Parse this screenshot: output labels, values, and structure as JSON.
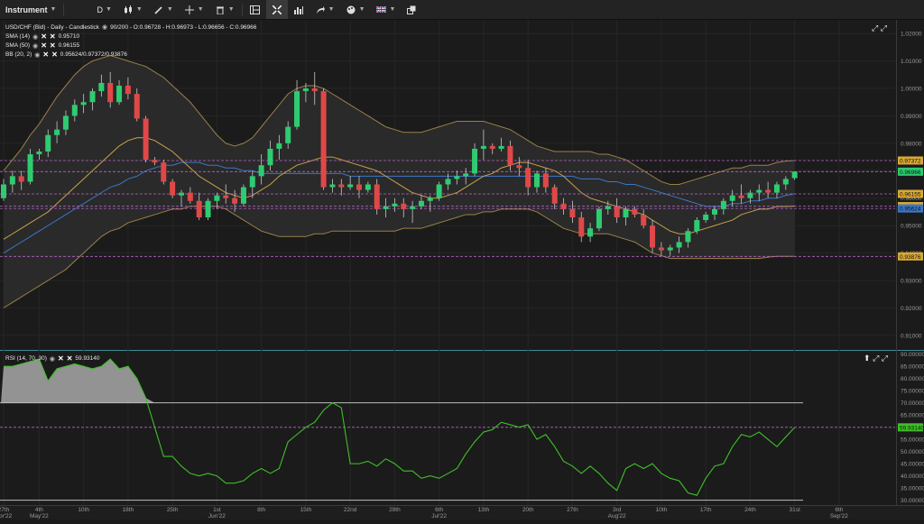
{
  "toolbar": {
    "instrument_label": "Instrument",
    "timeframe_label": "D"
  },
  "main_panel": {
    "title": "USD/CHF (Bid) - Daily - Candlestick",
    "ohlc": "90/200 - O:0.96728 - H:0.96973 - L:0.96656 - C:0.96966",
    "indicators": [
      {
        "name": "SMA (14)",
        "value": "0.95710"
      },
      {
        "name": "SMA (50)",
        "value": "0.96155"
      },
      {
        "name": "BB (20, 2)",
        "value": "0.95624/0.97372/0.93876"
      }
    ]
  },
  "rsi_panel": {
    "title": "RSI (14, 70, 30)",
    "value": "59.93140"
  },
  "colors": {
    "bg": "#1b1b1b",
    "up": "#2ecc71",
    "down": "#e04848",
    "sma14": "#c8a24a",
    "sma50": "#3a78c8",
    "bb": "#9a8048",
    "rsi": "#3fbf2a",
    "hline": "#b865c9"
  },
  "chart_data": [
    {
      "type": "candlestick",
      "title": "USD/CHF (Bid) - Daily - Candlestick",
      "ylim": [
        0.905,
        1.025
      ],
      "y_ticks": [
        "1.02000",
        "1.01000",
        "1.00000",
        "0.99000",
        "0.98000",
        "0.97000",
        "0.96000",
        "0.95000",
        "0.94000",
        "0.93000",
        "0.92000",
        "0.91000"
      ],
      "x_ticks": [
        {
          "i": 0,
          "label": "27th",
          "sub": "Apr'22"
        },
        {
          "i": 4,
          "label": "4th",
          "sub": "May'22"
        },
        {
          "i": 9,
          "label": "10th",
          "sub": ""
        },
        {
          "i": 14,
          "label": "18th",
          "sub": ""
        },
        {
          "i": 19,
          "label": "25th",
          "sub": ""
        },
        {
          "i": 24,
          "label": "1st",
          "sub": "Jun'22"
        },
        {
          "i": 29,
          "label": "8th",
          "sub": ""
        },
        {
          "i": 34,
          "label": "15th",
          "sub": ""
        },
        {
          "i": 39,
          "label": "22nd",
          "sub": ""
        },
        {
          "i": 44,
          "label": "29th",
          "sub": ""
        },
        {
          "i": 49,
          "label": "6th",
          "sub": "Jul'22"
        },
        {
          "i": 54,
          "label": "13th",
          "sub": ""
        },
        {
          "i": 59,
          "label": "20th",
          "sub": ""
        },
        {
          "i": 64,
          "label": "27th",
          "sub": ""
        },
        {
          "i": 69,
          "label": "3rd",
          "sub": "Aug'22"
        },
        {
          "i": 74,
          "label": "10th",
          "sub": ""
        },
        {
          "i": 79,
          "label": "17th",
          "sub": ""
        },
        {
          "i": 84,
          "label": "24th",
          "sub": ""
        },
        {
          "i": 89,
          "label": "31st",
          "sub": ""
        },
        {
          "i": 94,
          "label": "6th",
          "sub": "Sep'22"
        }
      ],
      "candles": [
        [
          0.96,
          0.967,
          0.959,
          0.965
        ],
        [
          0.965,
          0.97,
          0.962,
          0.968
        ],
        [
          0.968,
          0.97,
          0.963,
          0.966
        ],
        [
          0.966,
          0.978,
          0.965,
          0.976
        ],
        [
          0.976,
          0.978,
          0.974,
          0.977
        ],
        [
          0.977,
          0.985,
          0.975,
          0.983
        ],
        [
          0.983,
          0.988,
          0.98,
          0.985
        ],
        [
          0.985,
          0.992,
          0.983,
          0.99
        ],
        [
          0.99,
          0.996,
          0.988,
          0.994
        ],
        [
          0.994,
          0.998,
          0.991,
          0.995
        ],
        [
          0.995,
          1.0,
          0.992,
          0.999
        ],
        [
          0.999,
          1.005,
          0.997,
          1.002
        ],
        [
          1.002,
          1.006,
          0.993,
          0.995
        ],
        [
          0.995,
          1.003,
          0.994,
          1.001
        ],
        [
          1.001,
          1.004,
          0.996,
          0.998
        ],
        [
          0.998,
          1.0,
          0.988,
          0.989
        ],
        [
          0.989,
          0.99,
          0.973,
          0.974
        ],
        [
          0.974,
          0.975,
          0.972,
          0.973
        ],
        [
          0.973,
          0.974,
          0.965,
          0.966
        ],
        [
          0.966,
          0.967,
          0.96,
          0.961
        ],
        [
          0.961,
          0.963,
          0.957,
          0.962
        ],
        [
          0.962,
          0.964,
          0.958,
          0.959
        ],
        [
          0.959,
          0.962,
          0.952,
          0.953
        ],
        [
          0.953,
          0.96,
          0.952,
          0.959
        ],
        [
          0.959,
          0.962,
          0.956,
          0.961
        ],
        [
          0.961,
          0.965,
          0.958,
          0.96
        ],
        [
          0.96,
          0.963,
          0.955,
          0.958
        ],
        [
          0.958,
          0.965,
          0.957,
          0.964
        ],
        [
          0.964,
          0.97,
          0.96,
          0.968
        ],
        [
          0.968,
          0.976,
          0.965,
          0.972
        ],
        [
          0.972,
          0.981,
          0.97,
          0.978
        ],
        [
          0.978,
          0.983,
          0.974,
          0.98
        ],
        [
          0.98,
          0.988,
          0.978,
          0.986
        ],
        [
          0.986,
          1.003,
          0.985,
          0.999
        ],
        [
          0.999,
          1.002,
          0.995,
          1.0
        ],
        [
          1.0,
          1.006,
          0.994,
          0.999
        ],
        [
          0.999,
          1.0,
          0.963,
          0.964
        ],
        [
          0.964,
          0.967,
          0.962,
          0.965
        ],
        [
          0.965,
          0.967,
          0.961,
          0.964
        ],
        [
          0.964,
          0.968,
          0.963,
          0.965
        ],
        [
          0.965,
          0.968,
          0.96,
          0.963
        ],
        [
          0.963,
          0.966,
          0.962,
          0.965
        ],
        [
          0.965,
          0.967,
          0.954,
          0.956
        ],
        [
          0.956,
          0.96,
          0.953,
          0.957
        ],
        [
          0.957,
          0.96,
          0.955,
          0.958
        ],
        [
          0.958,
          0.96,
          0.953,
          0.956
        ],
        [
          0.956,
          0.959,
          0.951,
          0.957
        ],
        [
          0.957,
          0.961,
          0.956,
          0.959
        ],
        [
          0.959,
          0.961,
          0.955,
          0.96
        ],
        [
          0.96,
          0.966,
          0.959,
          0.965
        ],
        [
          0.965,
          0.969,
          0.963,
          0.967
        ],
        [
          0.967,
          0.97,
          0.965,
          0.968
        ],
        [
          0.968,
          0.971,
          0.965,
          0.969
        ],
        [
          0.969,
          0.98,
          0.968,
          0.978
        ],
        [
          0.978,
          0.985,
          0.974,
          0.979
        ],
        [
          0.979,
          0.98,
          0.976,
          0.978
        ],
        [
          0.978,
          0.982,
          0.977,
          0.979
        ],
        [
          0.979,
          0.981,
          0.97,
          0.972
        ],
        [
          0.972,
          0.975,
          0.968,
          0.971
        ],
        [
          0.971,
          0.974,
          0.961,
          0.964
        ],
        [
          0.964,
          0.97,
          0.962,
          0.969
        ],
        [
          0.969,
          0.971,
          0.962,
          0.964
        ],
        [
          0.964,
          0.965,
          0.956,
          0.958
        ],
        [
          0.958,
          0.96,
          0.954,
          0.956
        ],
        [
          0.956,
          0.959,
          0.951,
          0.953
        ],
        [
          0.953,
          0.955,
          0.944,
          0.946
        ],
        [
          0.946,
          0.951,
          0.944,
          0.949
        ],
        [
          0.949,
          0.957,
          0.948,
          0.956
        ],
        [
          0.956,
          0.959,
          0.954,
          0.957
        ],
        [
          0.957,
          0.96,
          0.951,
          0.953
        ],
        [
          0.953,
          0.957,
          0.95,
          0.956
        ],
        [
          0.956,
          0.957,
          0.953,
          0.954
        ],
        [
          0.954,
          0.956,
          0.949,
          0.95
        ],
        [
          0.95,
          0.952,
          0.94,
          0.942
        ],
        [
          0.942,
          0.944,
          0.939,
          0.941
        ],
        [
          0.941,
          0.943,
          0.939,
          0.942
        ],
        [
          0.942,
          0.946,
          0.94,
          0.944
        ],
        [
          0.944,
          0.949,
          0.942,
          0.948
        ],
        [
          0.948,
          0.953,
          0.947,
          0.952
        ],
        [
          0.952,
          0.955,
          0.951,
          0.954
        ],
        [
          0.954,
          0.957,
          0.952,
          0.956
        ],
        [
          0.956,
          0.96,
          0.954,
          0.959
        ],
        [
          0.959,
          0.963,
          0.957,
          0.961
        ],
        [
          0.961,
          0.965,
          0.958,
          0.96
        ],
        [
          0.96,
          0.963,
          0.958,
          0.962
        ],
        [
          0.962,
          0.965,
          0.959,
          0.963
        ],
        [
          0.963,
          0.966,
          0.96,
          0.962
        ],
        [
          0.962,
          0.966,
          0.96,
          0.965
        ],
        [
          0.965,
          0.968,
          0.963,
          0.967
        ],
        [
          0.9673,
          0.9697,
          0.9666,
          0.9697
        ]
      ],
      "sma14": [
        0.945,
        0.947,
        0.949,
        0.951,
        0.953,
        0.955,
        0.958,
        0.961,
        0.964,
        0.967,
        0.97,
        0.973,
        0.976,
        0.979,
        0.981,
        0.982,
        0.982,
        0.981,
        0.979,
        0.977,
        0.974,
        0.971,
        0.968,
        0.966,
        0.964,
        0.962,
        0.961,
        0.96,
        0.961,
        0.963,
        0.965,
        0.968,
        0.97,
        0.972,
        0.973,
        0.974,
        0.975,
        0.975,
        0.974,
        0.973,
        0.972,
        0.971,
        0.97,
        0.968,
        0.966,
        0.964,
        0.962,
        0.961,
        0.96,
        0.96,
        0.961,
        0.962,
        0.964,
        0.966,
        0.968,
        0.969,
        0.971,
        0.972,
        0.973,
        0.973,
        0.972,
        0.971,
        0.97,
        0.968,
        0.965,
        0.962,
        0.96,
        0.959,
        0.958,
        0.957,
        0.956,
        0.955,
        0.954,
        0.952,
        0.95,
        0.948,
        0.947,
        0.947,
        0.948,
        0.949,
        0.95,
        0.951,
        0.952,
        0.954,
        0.955,
        0.956,
        0.956,
        0.957,
        0.957,
        0.9571
      ],
      "sma50": [
        0.94,
        0.942,
        0.944,
        0.946,
        0.948,
        0.95,
        0.952,
        0.954,
        0.956,
        0.958,
        0.96,
        0.962,
        0.964,
        0.965,
        0.967,
        0.968,
        0.97,
        0.971,
        0.972,
        0.972,
        0.973,
        0.973,
        0.973,
        0.972,
        0.972,
        0.971,
        0.971,
        0.97,
        0.97,
        0.969,
        0.969,
        0.969,
        0.969,
        0.969,
        0.969,
        0.969,
        0.969,
        0.969,
        0.969,
        0.968,
        0.968,
        0.968,
        0.968,
        0.968,
        0.968,
        0.968,
        0.968,
        0.968,
        0.968,
        0.968,
        0.968,
        0.968,
        0.968,
        0.968,
        0.968,
        0.968,
        0.968,
        0.968,
        0.968,
        0.968,
        0.968,
        0.968,
        0.968,
        0.968,
        0.968,
        0.967,
        0.967,
        0.967,
        0.966,
        0.966,
        0.965,
        0.965,
        0.964,
        0.963,
        0.962,
        0.961,
        0.96,
        0.959,
        0.958,
        0.957,
        0.957,
        0.957,
        0.958,
        0.958,
        0.959,
        0.959,
        0.96,
        0.96,
        0.961,
        0.9616
      ],
      "bb_upper": [
        0.97,
        0.974,
        0.978,
        0.983,
        0.987,
        0.992,
        0.997,
        1.001,
        1.005,
        1.008,
        1.01,
        1.011,
        1.012,
        1.011,
        1.01,
        1.009,
        1.008,
        1.006,
        1.004,
        1.001,
        0.998,
        0.995,
        0.991,
        0.987,
        0.983,
        0.98,
        0.979,
        0.98,
        0.982,
        0.986,
        0.99,
        0.994,
        0.998,
        1.0,
        1.001,
        1.001,
        1.0,
        0.998,
        0.996,
        0.994,
        0.992,
        0.99,
        0.988,
        0.986,
        0.985,
        0.984,
        0.984,
        0.984,
        0.985,
        0.986,
        0.987,
        0.988,
        0.988,
        0.988,
        0.988,
        0.987,
        0.986,
        0.985,
        0.983,
        0.981,
        0.979,
        0.978,
        0.977,
        0.977,
        0.977,
        0.977,
        0.977,
        0.976,
        0.976,
        0.975,
        0.974,
        0.972,
        0.97,
        0.968,
        0.966,
        0.965,
        0.965,
        0.966,
        0.967,
        0.968,
        0.969,
        0.97,
        0.971,
        0.971,
        0.972,
        0.972,
        0.972,
        0.973,
        0.9735,
        0.9737
      ],
      "bb_lower": [
        0.92,
        0.922,
        0.924,
        0.926,
        0.928,
        0.93,
        0.932,
        0.934,
        0.937,
        0.94,
        0.943,
        0.946,
        0.948,
        0.949,
        0.951,
        0.952,
        0.953,
        0.954,
        0.955,
        0.956,
        0.956,
        0.957,
        0.957,
        0.957,
        0.957,
        0.956,
        0.954,
        0.952,
        0.95,
        0.948,
        0.947,
        0.946,
        0.946,
        0.946,
        0.946,
        0.947,
        0.947,
        0.948,
        0.948,
        0.948,
        0.948,
        0.948,
        0.948,
        0.948,
        0.948,
        0.949,
        0.949,
        0.949,
        0.95,
        0.951,
        0.952,
        0.953,
        0.954,
        0.954,
        0.955,
        0.955,
        0.956,
        0.956,
        0.956,
        0.956,
        0.955,
        0.953,
        0.951,
        0.949,
        0.948,
        0.947,
        0.947,
        0.947,
        0.947,
        0.946,
        0.945,
        0.944,
        0.942,
        0.94,
        0.939,
        0.938,
        0.938,
        0.938,
        0.938,
        0.938,
        0.938,
        0.938,
        0.938,
        0.938,
        0.938,
        0.938,
        0.9385,
        0.9388,
        0.9388,
        0.9388
      ],
      "hlines": [
        0.97372,
        0.96966,
        0.96155,
        0.9571,
        0.95624,
        0.93876
      ],
      "price_labels": [
        {
          "value": 0.97372,
          "text": "0.97372",
          "color": "#d9a834"
        },
        {
          "value": 0.96966,
          "text": "0.96966",
          "color": "#2ecc71"
        },
        {
          "value": 0.96155,
          "text": "0.96155",
          "color": "#d9a834"
        },
        {
          "value": 0.9571,
          "text": "0.95710",
          "color": "#d9a834"
        },
        {
          "value": 0.95624,
          "text": "0.95624",
          "color": "#3a78c8"
        },
        {
          "value": 0.93876,
          "text": "0.93876",
          "color": "#d9a834"
        }
      ]
    },
    {
      "type": "line",
      "title": "RSI (14, 70, 30)",
      "ylim": [
        28,
        91
      ],
      "y_ticks": [
        "90.00000",
        "85.00000",
        "80.00000",
        "75.00000",
        "70.00000",
        "65.00000",
        "60.00000",
        "55.00000",
        "50.00000",
        "45.00000",
        "40.00000",
        "35.00000",
        "30.00000"
      ],
      "overbought": 70,
      "oversold": 30,
      "current": 59.9314,
      "values": [
        85,
        85,
        86,
        87,
        88,
        79,
        84,
        85,
        86,
        85,
        84,
        85,
        88,
        84,
        85,
        80,
        72,
        60,
        48,
        48,
        44,
        41,
        40,
        41,
        40,
        37,
        37,
        38,
        41,
        43,
        41,
        43,
        54,
        57,
        60,
        62,
        67,
        70,
        68,
        45,
        45,
        46,
        44,
        47,
        45,
        42,
        42,
        39,
        40,
        39,
        41,
        43,
        49,
        54,
        58,
        59,
        62,
        61,
        60,
        61,
        55,
        57,
        52,
        46,
        44,
        41,
        44,
        41,
        37,
        34,
        43,
        45,
        43,
        45,
        41,
        39,
        38,
        33,
        32,
        39,
        44,
        45,
        52,
        57,
        56,
        58,
        55,
        52,
        56,
        59.9
      ]
    }
  ]
}
